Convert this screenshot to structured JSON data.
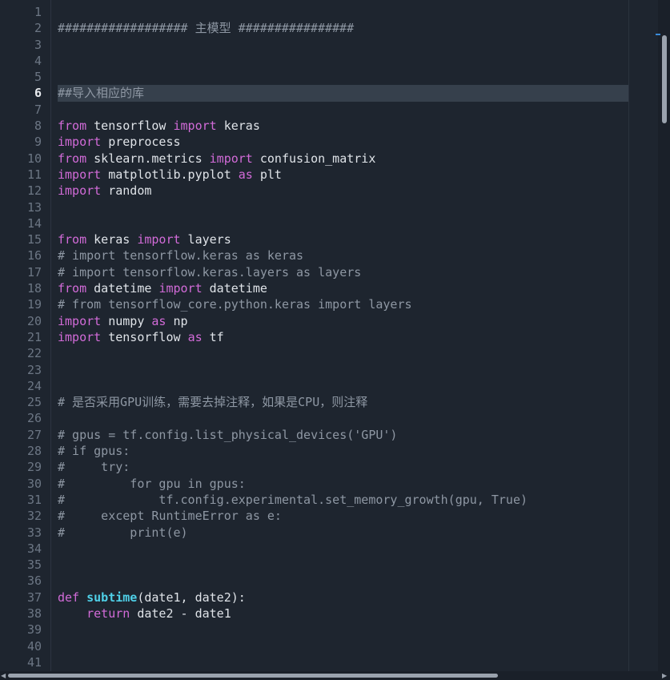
{
  "editor": {
    "current_line": 6,
    "colors": {
      "background": "#1e252f",
      "keyword": "#d26bd8",
      "function_name": "#4fd0e8",
      "comment": "#8e97a3",
      "text": "#dfe3e8",
      "line_number": "#6c7684",
      "current_line_bg": "#36404c"
    },
    "lines": [
      {
        "n": "1",
        "tokens": []
      },
      {
        "n": "2",
        "tokens": [
          {
            "t": "cm",
            "v": "################## 主模型 ################"
          }
        ]
      },
      {
        "n": "3",
        "tokens": []
      },
      {
        "n": "4",
        "tokens": []
      },
      {
        "n": "5",
        "tokens": []
      },
      {
        "n": "6",
        "tokens": [
          {
            "t": "cm",
            "v": "##导入相应的库"
          }
        ]
      },
      {
        "n": "7",
        "tokens": []
      },
      {
        "n": "8",
        "tokens": [
          {
            "t": "kw",
            "v": "from"
          },
          {
            "t": "tx",
            "v": " tensorflow "
          },
          {
            "t": "kw",
            "v": "import"
          },
          {
            "t": "tx",
            "v": " keras"
          }
        ]
      },
      {
        "n": "9",
        "tokens": [
          {
            "t": "kw",
            "v": "import"
          },
          {
            "t": "tx",
            "v": " preprocess"
          }
        ]
      },
      {
        "n": "10",
        "tokens": [
          {
            "t": "kw",
            "v": "from"
          },
          {
            "t": "tx",
            "v": " sklearn.metrics "
          },
          {
            "t": "kw",
            "v": "import"
          },
          {
            "t": "tx",
            "v": " confusion_matrix"
          }
        ]
      },
      {
        "n": "11",
        "tokens": [
          {
            "t": "kw",
            "v": "import"
          },
          {
            "t": "tx",
            "v": " matplotlib.pyplot "
          },
          {
            "t": "kw",
            "v": "as"
          },
          {
            "t": "tx",
            "v": " plt"
          }
        ]
      },
      {
        "n": "12",
        "tokens": [
          {
            "t": "kw",
            "v": "import"
          },
          {
            "t": "tx",
            "v": " random"
          }
        ]
      },
      {
        "n": "13",
        "tokens": []
      },
      {
        "n": "14",
        "tokens": []
      },
      {
        "n": "15",
        "tokens": [
          {
            "t": "kw",
            "v": "from"
          },
          {
            "t": "tx",
            "v": " keras "
          },
          {
            "t": "kw",
            "v": "import"
          },
          {
            "t": "tx",
            "v": " layers"
          }
        ]
      },
      {
        "n": "16",
        "tokens": [
          {
            "t": "cm",
            "v": "# import tensorflow.keras as keras"
          }
        ]
      },
      {
        "n": "17",
        "tokens": [
          {
            "t": "cm",
            "v": "# import tensorflow.keras.layers as layers"
          }
        ]
      },
      {
        "n": "18",
        "tokens": [
          {
            "t": "kw",
            "v": "from"
          },
          {
            "t": "tx",
            "v": " datetime "
          },
          {
            "t": "kw",
            "v": "import"
          },
          {
            "t": "tx",
            "v": " datetime"
          }
        ]
      },
      {
        "n": "19",
        "tokens": [
          {
            "t": "cm",
            "v": "# from tensorflow_core.python.keras import layers"
          }
        ]
      },
      {
        "n": "20",
        "tokens": [
          {
            "t": "kw",
            "v": "import"
          },
          {
            "t": "tx",
            "v": " numpy "
          },
          {
            "t": "kw",
            "v": "as"
          },
          {
            "t": "tx",
            "v": " np"
          }
        ]
      },
      {
        "n": "21",
        "tokens": [
          {
            "t": "kw",
            "v": "import"
          },
          {
            "t": "tx",
            "v": " tensorflow "
          },
          {
            "t": "kw",
            "v": "as"
          },
          {
            "t": "tx",
            "v": " tf"
          }
        ]
      },
      {
        "n": "22",
        "tokens": []
      },
      {
        "n": "23",
        "tokens": []
      },
      {
        "n": "24",
        "tokens": []
      },
      {
        "n": "25",
        "tokens": [
          {
            "t": "cm",
            "v": "# 是否采用GPU训练，需要去掉注释，如果是CPU，则注释"
          }
        ]
      },
      {
        "n": "26",
        "tokens": []
      },
      {
        "n": "27",
        "tokens": [
          {
            "t": "cm",
            "v": "# gpus = tf.config.list_physical_devices('GPU')"
          }
        ]
      },
      {
        "n": "28",
        "tokens": [
          {
            "t": "cm",
            "v": "# if gpus:"
          }
        ]
      },
      {
        "n": "29",
        "tokens": [
          {
            "t": "cm",
            "v": "#     try:"
          }
        ]
      },
      {
        "n": "30",
        "tokens": [
          {
            "t": "cm",
            "v": "#         for gpu in gpus:"
          }
        ]
      },
      {
        "n": "31",
        "tokens": [
          {
            "t": "cm",
            "v": "#             tf.config.experimental.set_memory_growth(gpu, True)"
          }
        ]
      },
      {
        "n": "32",
        "tokens": [
          {
            "t": "cm",
            "v": "#     except RuntimeError as e:"
          }
        ]
      },
      {
        "n": "33",
        "tokens": [
          {
            "t": "cm",
            "v": "#         print(e)"
          }
        ]
      },
      {
        "n": "34",
        "tokens": []
      },
      {
        "n": "35",
        "tokens": []
      },
      {
        "n": "36",
        "tokens": []
      },
      {
        "n": "37",
        "tokens": [
          {
            "t": "kw",
            "v": "def"
          },
          {
            "t": "tx",
            "v": " "
          },
          {
            "t": "fn",
            "v": "subtime"
          },
          {
            "t": "tx",
            "v": "(date1, date2):"
          }
        ]
      },
      {
        "n": "38",
        "tokens": [
          {
            "t": "tx",
            "v": "    "
          },
          {
            "t": "kw",
            "v": "return"
          },
          {
            "t": "tx",
            "v": " date2 - date1"
          }
        ]
      },
      {
        "n": "39",
        "tokens": []
      },
      {
        "n": "40",
        "tokens": []
      },
      {
        "n": "41",
        "tokens": []
      }
    ]
  },
  "scrollbars": {
    "vertical_position": 0.05,
    "horizontal_position": 0.0
  }
}
